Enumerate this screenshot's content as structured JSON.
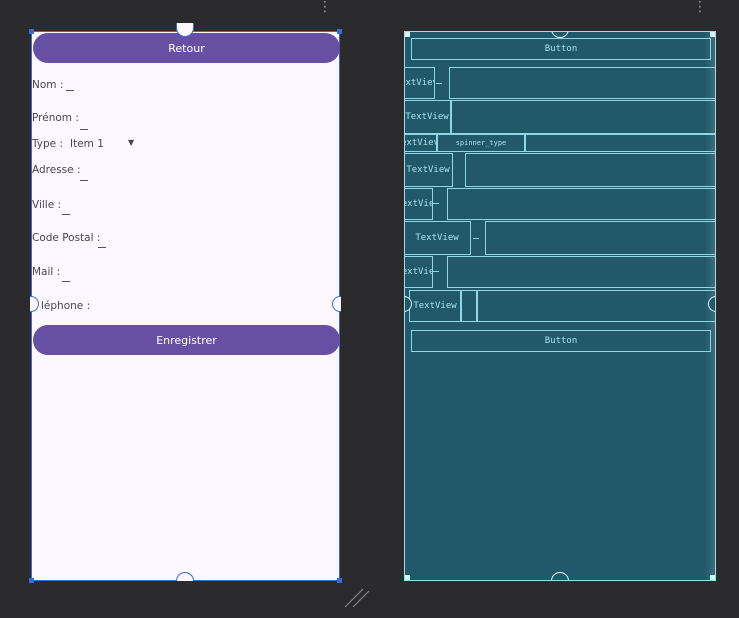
{
  "design": {
    "back_button": "Retour",
    "fields": [
      {
        "label": "Nom :",
        "value": "_"
      },
      {
        "label": "Prénom :",
        "value": "_"
      },
      {
        "label": "Type :",
        "value": "Item 1"
      },
      {
        "label": "Adresse :",
        "value": "_"
      },
      {
        "label": "Ville :",
        "value": "_"
      },
      {
        "label": "Code Postal :",
        "value": "_"
      },
      {
        "label": "Mail :",
        "value": "_"
      },
      {
        "label": "léphone :",
        "value": ""
      }
    ],
    "save_button": "Enregistrer"
  },
  "blueprint": {
    "top_button": "Button",
    "bottom_button": "Button",
    "rows": [
      {
        "label": "extViev"
      },
      {
        "label": "TextView"
      },
      {
        "label": "extViev",
        "spinner": "spinner_type"
      },
      {
        "label": "TextView"
      },
      {
        "label": "extVie"
      },
      {
        "label": "TextView"
      },
      {
        "label": "extVie"
      },
      {
        "label": "TextView"
      }
    ]
  },
  "colors": {
    "accent": "#6750a4",
    "selection": "#2f6fd6",
    "blueprint_bg": "#22596a",
    "blueprint_line": "#8fd6e6"
  }
}
